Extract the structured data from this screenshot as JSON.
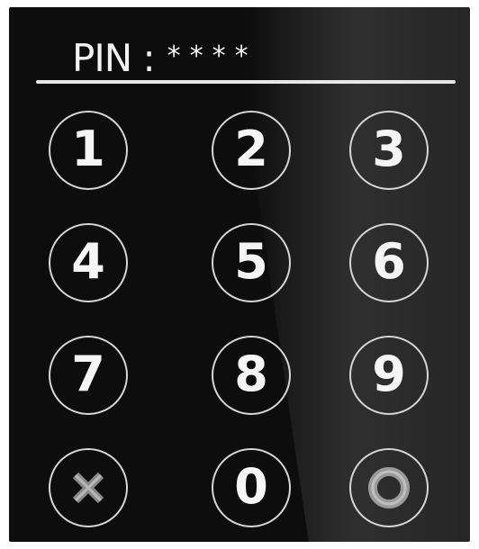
{
  "pin": {
    "label": "PIN :",
    "masked_value": "****"
  },
  "keypad": {
    "keys": [
      {
        "id": "1",
        "label": "1"
      },
      {
        "id": "2",
        "label": "2"
      },
      {
        "id": "3",
        "label": "3"
      },
      {
        "id": "4",
        "label": "4"
      },
      {
        "id": "5",
        "label": "5"
      },
      {
        "id": "6",
        "label": "6"
      },
      {
        "id": "7",
        "label": "7"
      },
      {
        "id": "8",
        "label": "8"
      },
      {
        "id": "9",
        "label": "9"
      },
      {
        "id": "cancel",
        "icon": "x-icon"
      },
      {
        "id": "0",
        "label": "0"
      },
      {
        "id": "confirm",
        "icon": "circle-o-icon"
      }
    ]
  },
  "colors": {
    "panel_background": "#0d0d0d",
    "text": "#f5f5f5",
    "ring": "#d6d6d6",
    "dim_key": "#8a8a8a"
  }
}
